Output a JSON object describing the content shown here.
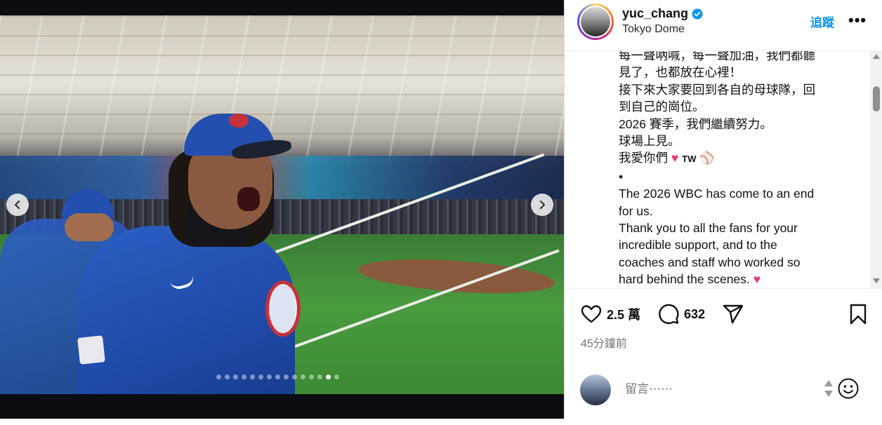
{
  "post": {
    "username": "yuc_chang",
    "location": "Tokyo Dome",
    "follow_label": "追蹤",
    "more_label": "•••",
    "caption_lines": [
      "每一聲吶喊，每一聲加油，我們都聽",
      "見了，也都放在心裡！",
      "接下來大家要回到各自的母球隊，回",
      "到自己的崗位。",
      "2026 賽季，我們繼續努力。",
      "球場上見。",
      "我愛你們",
      "•",
      "The 2026 WBC has come to an end",
      "for us.",
      "Thank you to all the fans for your",
      "incredible support, and to the",
      "coaches and staff who worked so",
      "hard behind the scenes."
    ],
    "caption_emoji_tw": "TW",
    "likes_count": "2.5 萬",
    "comments_count": "632",
    "timestamp": "45分鐘前",
    "comment_placeholder": "留言⋯⋯"
  },
  "carousel": {
    "total_slides": 15,
    "active_index": 13
  },
  "icons": {
    "prev": "chevron-left-icon",
    "next": "chevron-right-icon",
    "verified": "verified-badge-icon",
    "like": "heart-icon",
    "comment": "comment-bubble-icon",
    "share": "send-paper-plane-icon",
    "save": "bookmark-icon",
    "emoji": "smiley-icon"
  },
  "colors": {
    "accent": "#0095f6",
    "heart": "#e83c7a",
    "secondary_text": "#737373"
  }
}
